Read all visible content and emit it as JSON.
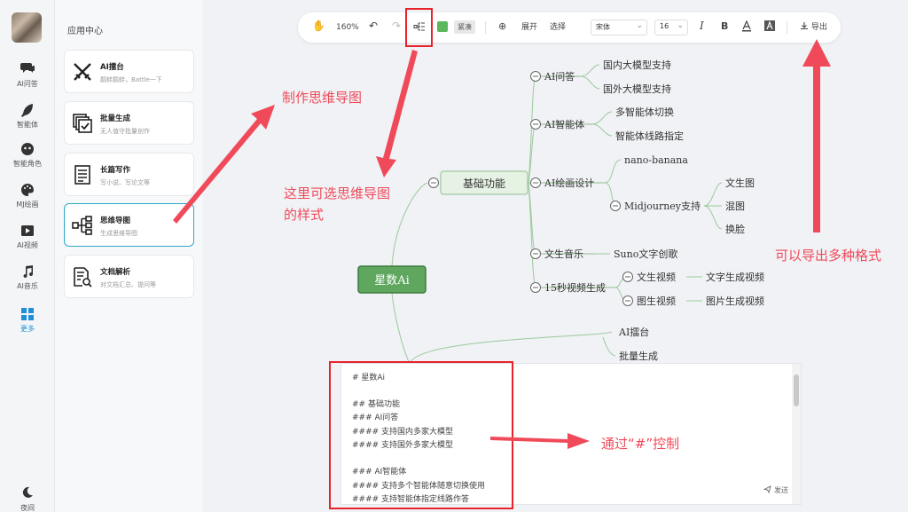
{
  "rail": {
    "items": [
      {
        "label": "AI问答",
        "icon": "chat-icon"
      },
      {
        "label": "智能体",
        "icon": "feather-icon"
      },
      {
        "label": "智能角色",
        "icon": "mask-icon"
      },
      {
        "label": "MJ绘画",
        "icon": "palette-icon"
      },
      {
        "label": "AI视频",
        "icon": "video-icon"
      },
      {
        "label": "AI音乐",
        "icon": "music-icon"
      },
      {
        "label": "更多",
        "icon": "grid-icon"
      }
    ],
    "night_label": "夜间"
  },
  "panel": {
    "title": "应用中心",
    "cards": [
      {
        "title": "AI擂台",
        "sub": "鹬蚌鹬蚌，Battle一下",
        "icon": "crossed-swords-icon"
      },
      {
        "title": "批量生成",
        "sub": "无人值守批量创作",
        "icon": "batch-check-icon"
      },
      {
        "title": "长篇写作",
        "sub": "写小说、写论文等",
        "icon": "document-list-icon"
      },
      {
        "title": "思维导图",
        "sub": "生成思维导图",
        "icon": "mindmap-icon"
      },
      {
        "title": "文档解析",
        "sub": "对文档汇总、提问等",
        "icon": "doc-search-icon"
      }
    ]
  },
  "toolbar": {
    "zoom": "160%",
    "compact": "紧凑",
    "expand": "展开",
    "select": "选择",
    "font": "宋体",
    "size": "16",
    "bold": "B",
    "export": "导出"
  },
  "mindmap": {
    "root": "星数Ai",
    "branch1": "基础功能",
    "ai_qa": "AI问答",
    "qa_domestic": "国内大模型支持",
    "qa_foreign": "国外大模型支持",
    "ai_agent": "AI智能体",
    "agent_switch": "多智能体切换",
    "agent_route": "智能体线路指定",
    "ai_draw": "AI绘画设计",
    "nano": "nano-banana",
    "mj": "Midjourney支持",
    "mj_t2i": "文生图",
    "mj_blend": "混图",
    "mj_swap": "换脸",
    "music": "文生音乐",
    "suno": "Suno文字创歌",
    "video": "15秒视频生成",
    "t2v": "文生视频",
    "t2v_leaf": "文字生成视频",
    "i2v": "图生视频",
    "i2v_leaf": "图片生成视频",
    "arena": "AI擂台",
    "batch": "批量生成"
  },
  "editor": {
    "lines": [
      "# 星数Ai",
      "",
      "## 基础功能",
      "### AI问答",
      "#### 支持国内多家大模型",
      "#### 支持国外多家大模型",
      "",
      "### AI智能体",
      "#### 支持多个智能体随意切换使用",
      "#### 支持智能体指定线路作答"
    ],
    "send": "发送"
  },
  "annotations": {
    "make_map": "制作思维导图",
    "choose_style_1": "这里可选思维导图",
    "choose_style_2": "的样式",
    "export_formats": "可以导出多种格式",
    "hash_control": "通过“#”控制"
  }
}
